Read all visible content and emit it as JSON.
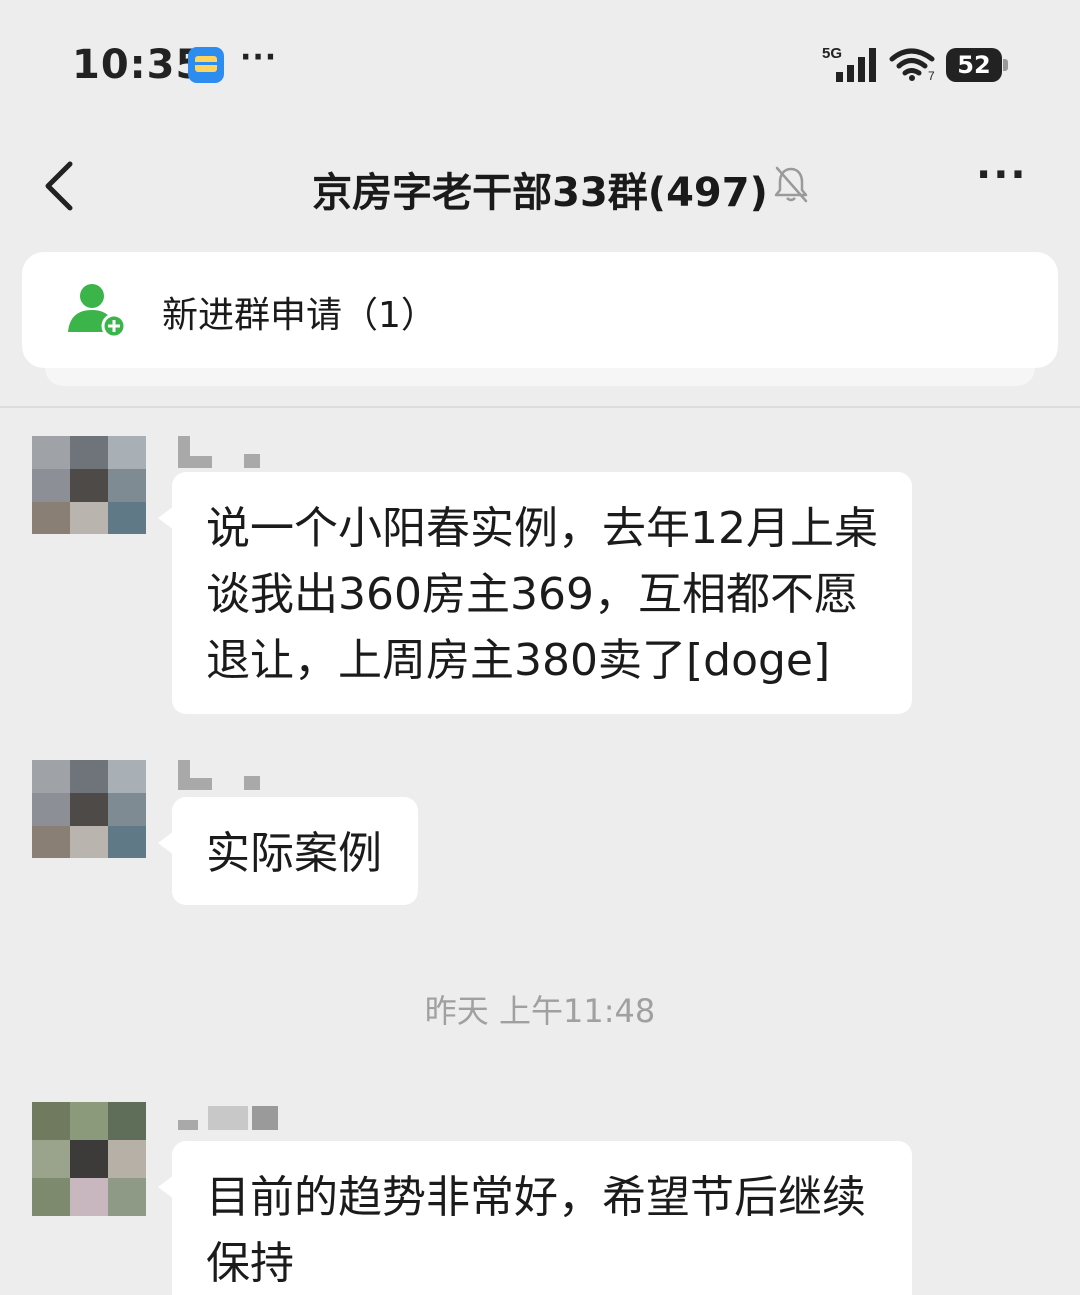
{
  "status_bar": {
    "time": "10:35",
    "more_indicator": "···",
    "network": "5G",
    "battery": "52"
  },
  "nav": {
    "title": "京房字老干部33群(497)",
    "back_icon": "chevron-left-icon",
    "mute_icon": "bell-off-icon",
    "more_label": "···"
  },
  "join_request": {
    "label": "新进群申请（1）",
    "icon": "add-user-icon",
    "icon_color": "#3bb44a"
  },
  "messages": [
    {
      "text": "说一个小阳春实例，去年12月上桌谈我出360房主369，互相都不愿退让，上周房主380卖了[doge]"
    },
    {
      "text": "实际案例"
    },
    {
      "text": "目前的趋势非常好，希望节后继续保持"
    }
  ],
  "timestamp": "昨天 上午11:48",
  "colors": {
    "background": "#ededed",
    "bubble": "#ffffff",
    "text": "#1b1b1b",
    "timestamp": "#a0a0a0"
  }
}
